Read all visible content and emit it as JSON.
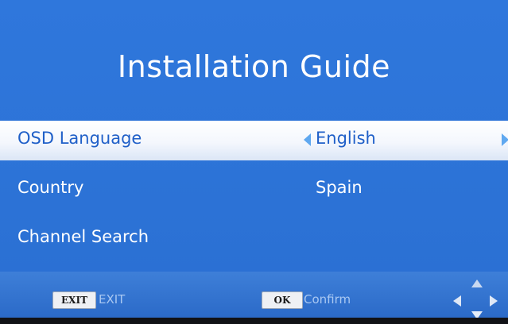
{
  "title": "Installation Guide",
  "menu": {
    "items": [
      {
        "label": "OSD Language",
        "value": "English"
      },
      {
        "label": "Country",
        "value": "Spain"
      },
      {
        "label": "Channel Search",
        "value": ""
      }
    ]
  },
  "footer": {
    "exit_key": "EXIT",
    "exit_label": "EXIT",
    "ok_key": "OK",
    "ok_label": "Confirm"
  },
  "icons": {
    "prev": "arrow-left-icon",
    "next": "arrow-right-icon",
    "navigation": "dpad-icon"
  },
  "colors": {
    "background": "#2d74d8",
    "highlight": "#ffffff",
    "selected_text": "#1f5fc8",
    "text": "#ffffff"
  }
}
